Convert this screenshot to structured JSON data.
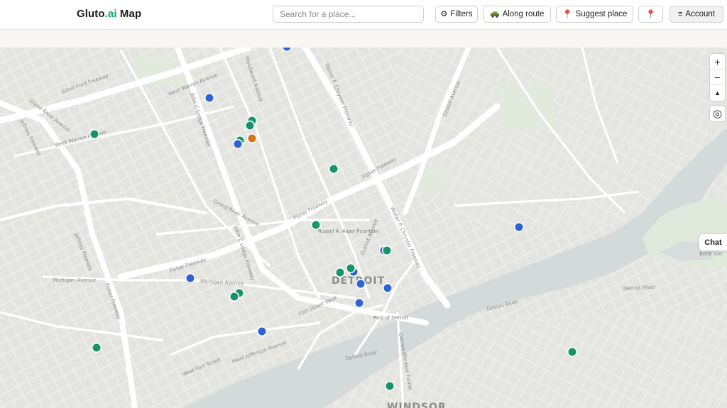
{
  "header": {
    "brand_prefix": "Gluto",
    "brand_accent": ".ai",
    "brand_suffix": " Map",
    "search_placeholder": "Search for a place...",
    "filters_label": "Filters",
    "filters_icon": "gear-icon",
    "along_route_label": "Along route",
    "along_route_icon": "car-icon",
    "suggest_label": "Suggest place",
    "suggest_icon": "pin-icon",
    "locate_icon": "pin-icon",
    "account_label": "Account",
    "account_icon": "menu-icon"
  },
  "map_controls": {
    "zoom_in": "+",
    "zoom_out": "−",
    "compass": "▲",
    "locate": "◎"
  },
  "chat_label": "Chat",
  "map_labels": {
    "city_detroit": "DETROIT",
    "city_windsor": "WINDSOR",
    "fountain": "Russel A. Alger Fountain",
    "port": "Port of Detroit",
    "edsel_ford": "Edsel Ford Freeway",
    "west_warren": "West Warren Avenue",
    "woodward": "Woodward Avenue",
    "john_lodge_1": "John C Lodge Freeway",
    "john_lodge_2": "John C Lodge Freeway",
    "chrysler_1": "Walter P. Chrysler Freeway",
    "chrysler_2": "Walter P. Chrysler Freeway",
    "gratiot_1": "Gratiot Avenue",
    "gratiot_2": "Gratiot Avenue",
    "grand_river_1": "Grand River Avenue",
    "grand_river_2": "Grand River Avenue",
    "fisher_1": "Fisher Freeway",
    "fisher_2": "Fisher Freeway",
    "fisher_3": "Fisher Freeway",
    "fisher_4": "Fisher Freeway",
    "jeffries_1": "Jeffries Freeway",
    "jeffries_2": "Jeffries Freeway",
    "michigan_1": "Michigan Avenue",
    "michigan_2": "Michigan Avenue",
    "fort_street": "Fort Street West",
    "west_jefferson": "West Jefferson Avenue",
    "west_fort": "West Fort Street",
    "detroit_river_1": "Detroit River",
    "detroit_river_2": "Detroit River",
    "detroit_river_3": "Detroit River",
    "ambassador": "Detroit-Windsor Tunnel",
    "belle_isle": "Belle Isle"
  },
  "colors": {
    "marker_green": "#17946a",
    "marker_blue": "#2e63d8",
    "marker_orange": "#d47418",
    "water": "#d6dbdc",
    "park": "#e3ebe0"
  },
  "markers": [
    {
      "color": "blue"
    },
    {
      "color": "blue"
    },
    {
      "color": "green"
    },
    {
      "color": "green"
    },
    {
      "color": "green"
    },
    {
      "color": "orange"
    },
    {
      "color": "blue"
    },
    {
      "color": "green"
    },
    {
      "color": "green"
    },
    {
      "color": "green"
    },
    {
      "color": "blue"
    },
    {
      "color": "blue"
    },
    {
      "color": "green"
    },
    {
      "color": "blue"
    },
    {
      "color": "green"
    },
    {
      "color": "green"
    },
    {
      "color": "blue"
    },
    {
      "color": "blue"
    },
    {
      "color": "blue"
    },
    {
      "color": "green"
    },
    {
      "color": "green"
    },
    {
      "color": "blue"
    },
    {
      "color": "blue"
    },
    {
      "color": "green"
    },
    {
      "color": "green"
    },
    {
      "color": "green"
    }
  ]
}
